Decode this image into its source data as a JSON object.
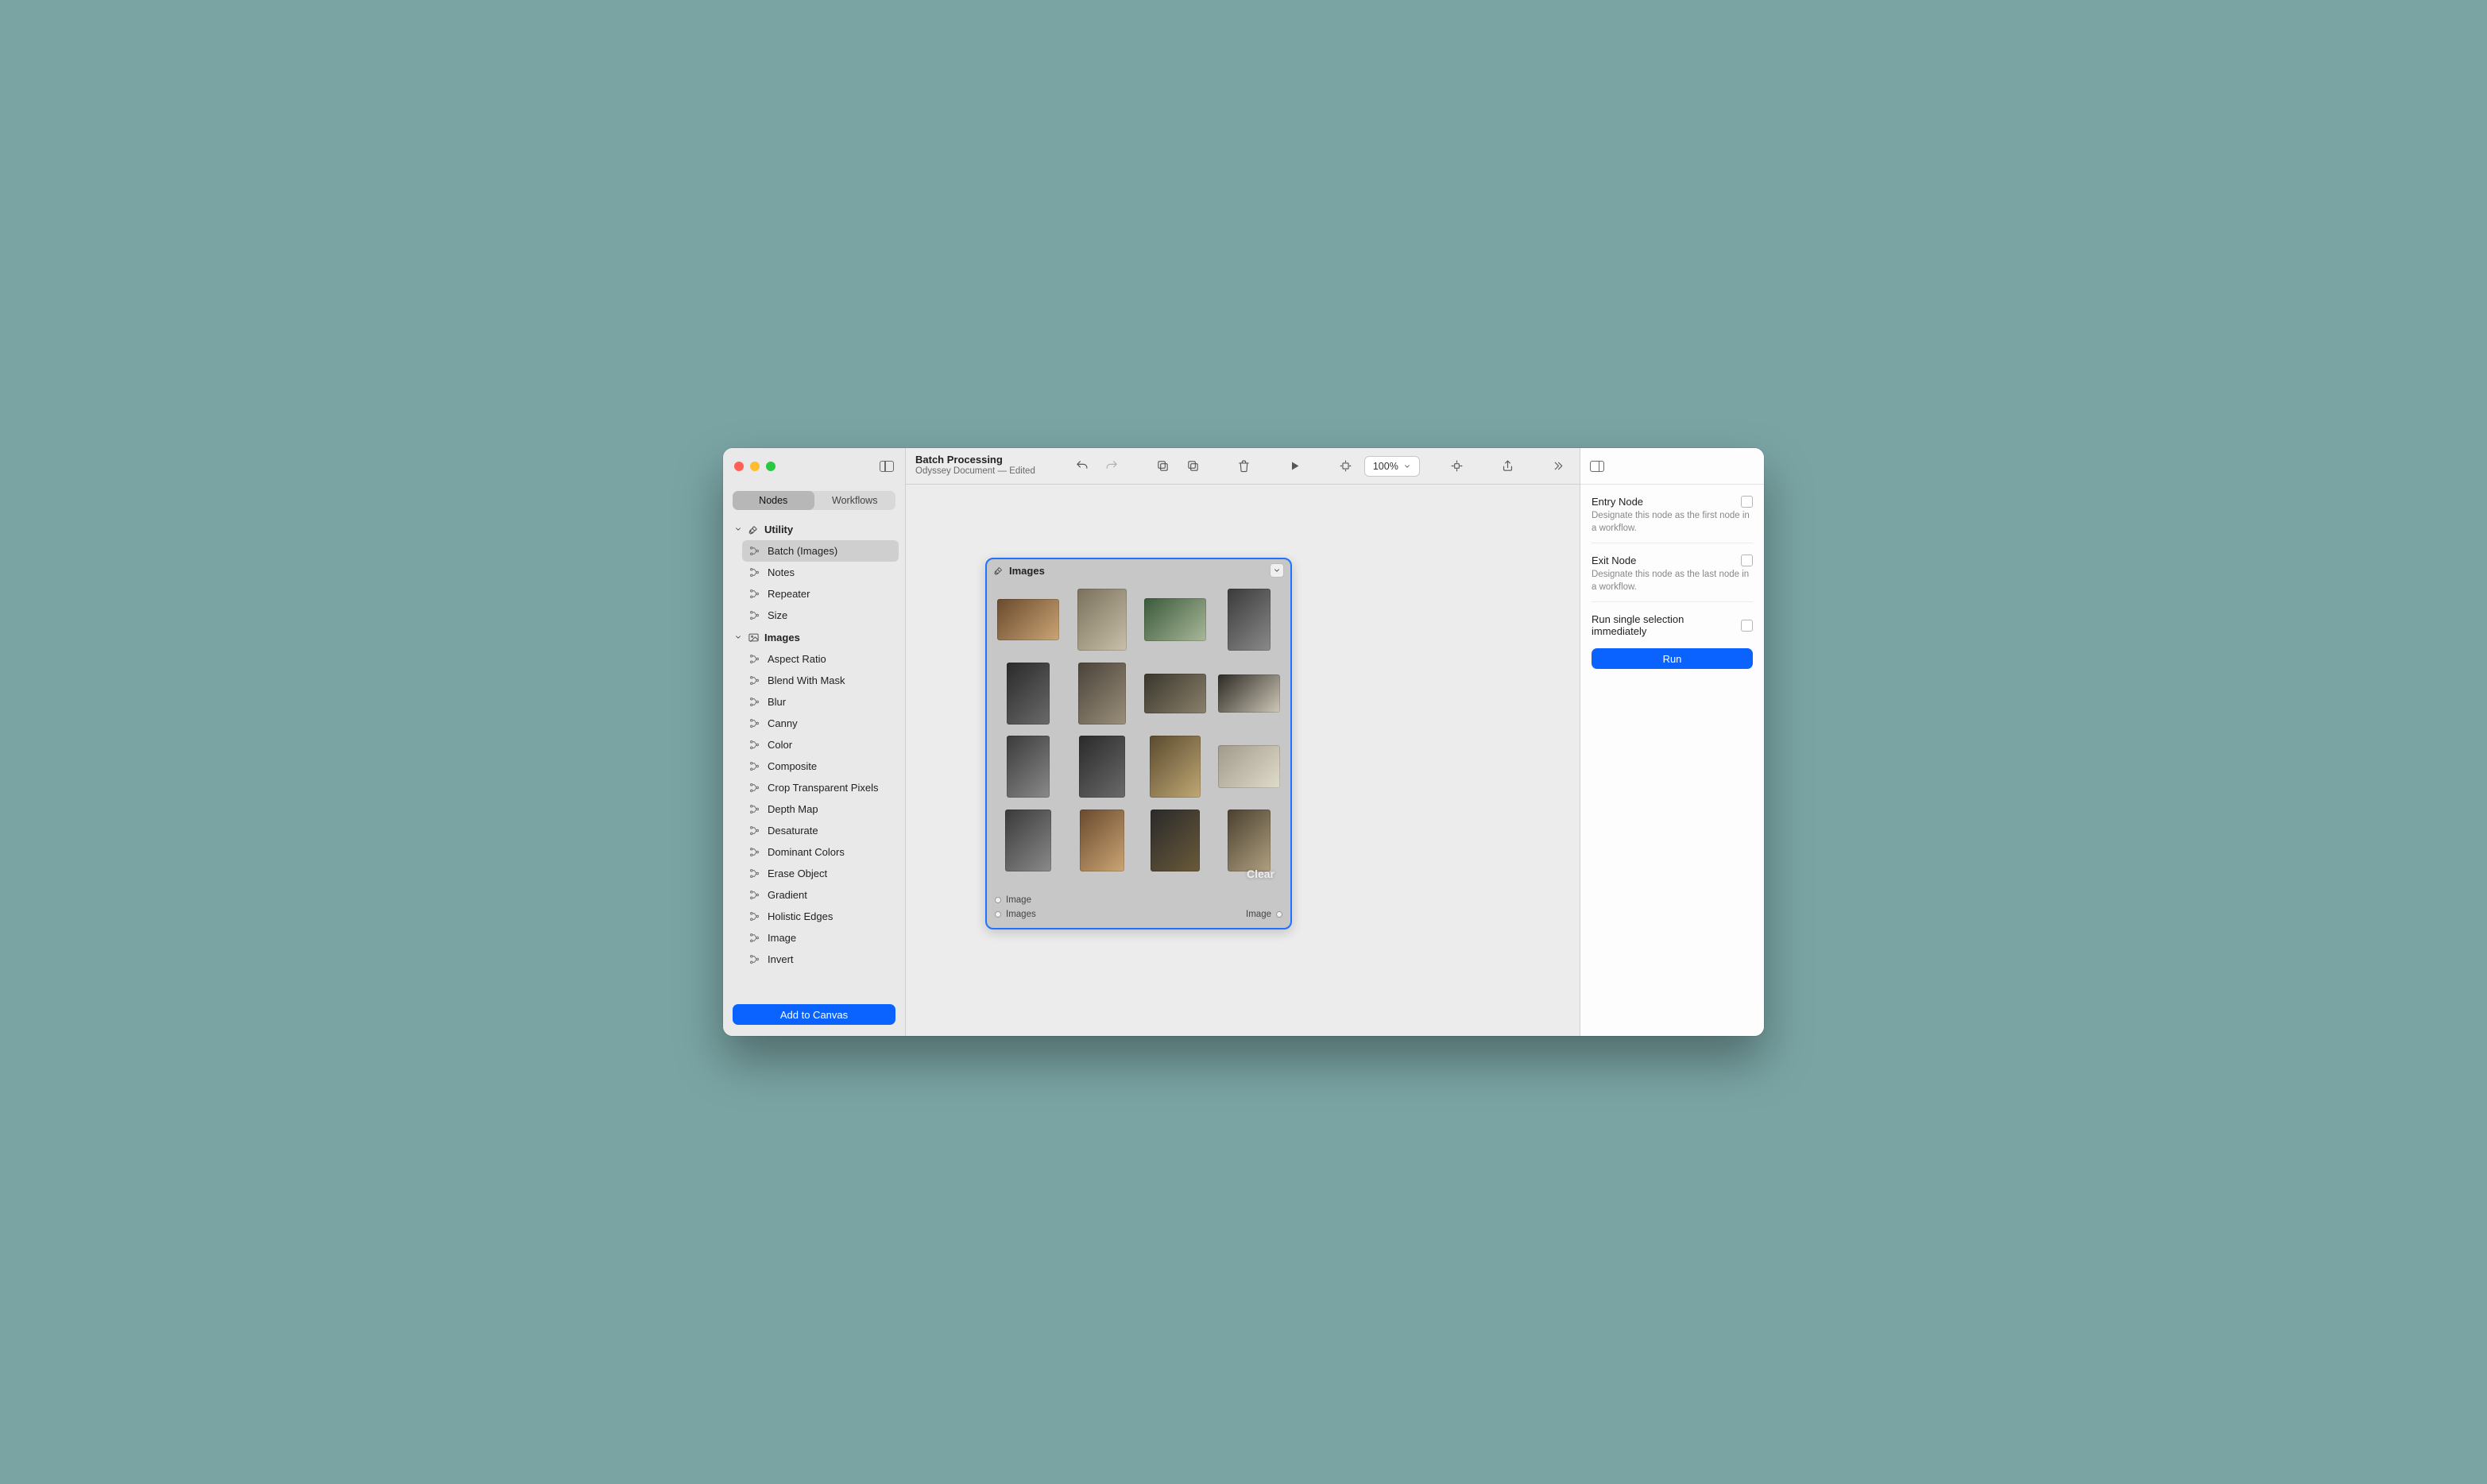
{
  "window": {
    "doc_title": "Batch Processing",
    "doc_subtitle": "Odyssey Document — Edited",
    "zoom_label": "100%"
  },
  "sidebar": {
    "tabs": {
      "nodes": "Nodes",
      "workflows": "Workflows"
    },
    "groups": [
      {
        "name": "Utility",
        "icon": "wrench",
        "items": [
          "Batch (Images)",
          "Notes",
          "Repeater",
          "Size"
        ],
        "active_index": 0
      },
      {
        "name": "Images",
        "icon": "picture",
        "items": [
          "Aspect Ratio",
          "Blend With Mask",
          "Blur",
          "Canny",
          "Color",
          "Composite",
          "Crop Transparent Pixels",
          "Depth Map",
          "Desaturate",
          "Dominant Colors",
          "Erase Object",
          "Gradient",
          "Holistic Edges",
          "Image",
          "Invert"
        ]
      }
    ],
    "add_button": "Add to Canvas"
  },
  "node": {
    "title": "Images",
    "ports_in": [
      "Image",
      "Images"
    ],
    "ports_out": [
      "Image"
    ],
    "clear_label": "Clear",
    "thumbnails": [
      {
        "w": 78,
        "h": 52,
        "c1": "#6a4a2e",
        "c2": "#caa574"
      },
      {
        "w": 62,
        "h": 78,
        "c1": "#7a715c",
        "c2": "#c9c0aa"
      },
      {
        "w": 78,
        "h": 54,
        "c1": "#3a5a3a",
        "c2": "#a9b89a"
      },
      {
        "w": 54,
        "h": 78,
        "c1": "#3a3a3a",
        "c2": "#8a8a8a"
      },
      {
        "w": 54,
        "h": 78,
        "c1": "#2a2a2a",
        "c2": "#6a6a6a"
      },
      {
        "w": 60,
        "h": 78,
        "c1": "#4a433a",
        "c2": "#9a8f7a"
      },
      {
        "w": 78,
        "h": 50,
        "c1": "#3a362e",
        "c2": "#8a806a"
      },
      {
        "w": 78,
        "h": 48,
        "c1": "#2d2a24",
        "c2": "#cfc8b8"
      },
      {
        "w": 54,
        "h": 78,
        "c1": "#3a3a3a",
        "c2": "#8a8a8a"
      },
      {
        "w": 58,
        "h": 78,
        "c1": "#2a2a2a",
        "c2": "#6a6a6a"
      },
      {
        "w": 64,
        "h": 78,
        "c1": "#5a4a2e",
        "c2": "#c0a874"
      },
      {
        "w": 78,
        "h": 54,
        "c1": "#a09a8a",
        "c2": "#e0dccc"
      },
      {
        "w": 58,
        "h": 78,
        "c1": "#3a3a3a",
        "c2": "#8a8a8a"
      },
      {
        "w": 56,
        "h": 78,
        "c1": "#6a4a2e",
        "c2": "#caa574"
      },
      {
        "w": 62,
        "h": 78,
        "c1": "#2a2a2a",
        "c2": "#6a5a3a"
      },
      {
        "w": 54,
        "h": 78,
        "c1": "#4a4030",
        "c2": "#b0a080"
      },
      {
        "w": 58,
        "h": 10,
        "c1": "#3a3a3a",
        "c2": "#8a8a8a"
      },
      {
        "w": 56,
        "h": 10,
        "c1": "#c0b8a0",
        "c2": "#e0d8c0"
      },
      {
        "w": 62,
        "h": 10,
        "c1": "#b0a890",
        "c2": "#d0c8b0"
      },
      {
        "w": 54,
        "h": 10,
        "c1": "#b0a890",
        "c2": "#d0c8b0"
      }
    ]
  },
  "inspector": {
    "entry": {
      "label": "Entry Node",
      "desc": "Designate this node as the first node in a workflow."
    },
    "exit": {
      "label": "Exit Node",
      "desc": "Designate this node as the last node in a workflow."
    },
    "run_selection": {
      "label": "Run single selection immediately"
    },
    "run_button": "Run"
  },
  "colors": {
    "accent": "#0a63ff",
    "selection": "#1e73ff"
  }
}
